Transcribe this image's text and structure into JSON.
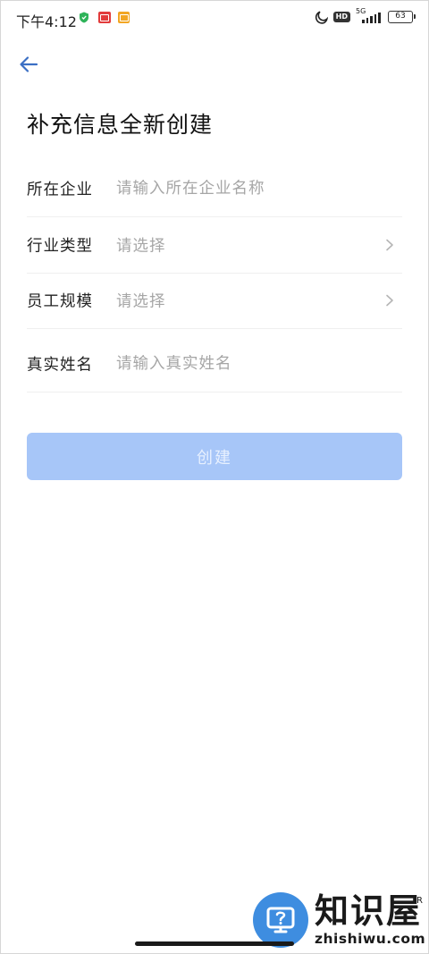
{
  "status_bar": {
    "time": "下午4:12",
    "network_label": "5G",
    "hd_label": "HD",
    "battery": "63"
  },
  "header": {
    "back_icon": "arrow-left-icon",
    "title": "补充信息全新创建"
  },
  "form": {
    "company": {
      "label": "所在企业",
      "placeholder": "请输入所在企业名称"
    },
    "industry": {
      "label": "行业类型",
      "value": "请选择"
    },
    "staff_size": {
      "label": "员工规模",
      "value": "请选择"
    },
    "real_name": {
      "label": "真实姓名",
      "placeholder": "请输入真实姓名"
    }
  },
  "create_button": {
    "label": "创建",
    "enabled": false
  },
  "watermark": {
    "brand": "知识屋",
    "url": "zhishiwu.com",
    "reg": "R"
  },
  "colors": {
    "accent": "#a7c6f8",
    "back_icon": "#3b6fc4",
    "placeholder": "#a6a6a6",
    "watermark_blue": "#3e8de0"
  }
}
